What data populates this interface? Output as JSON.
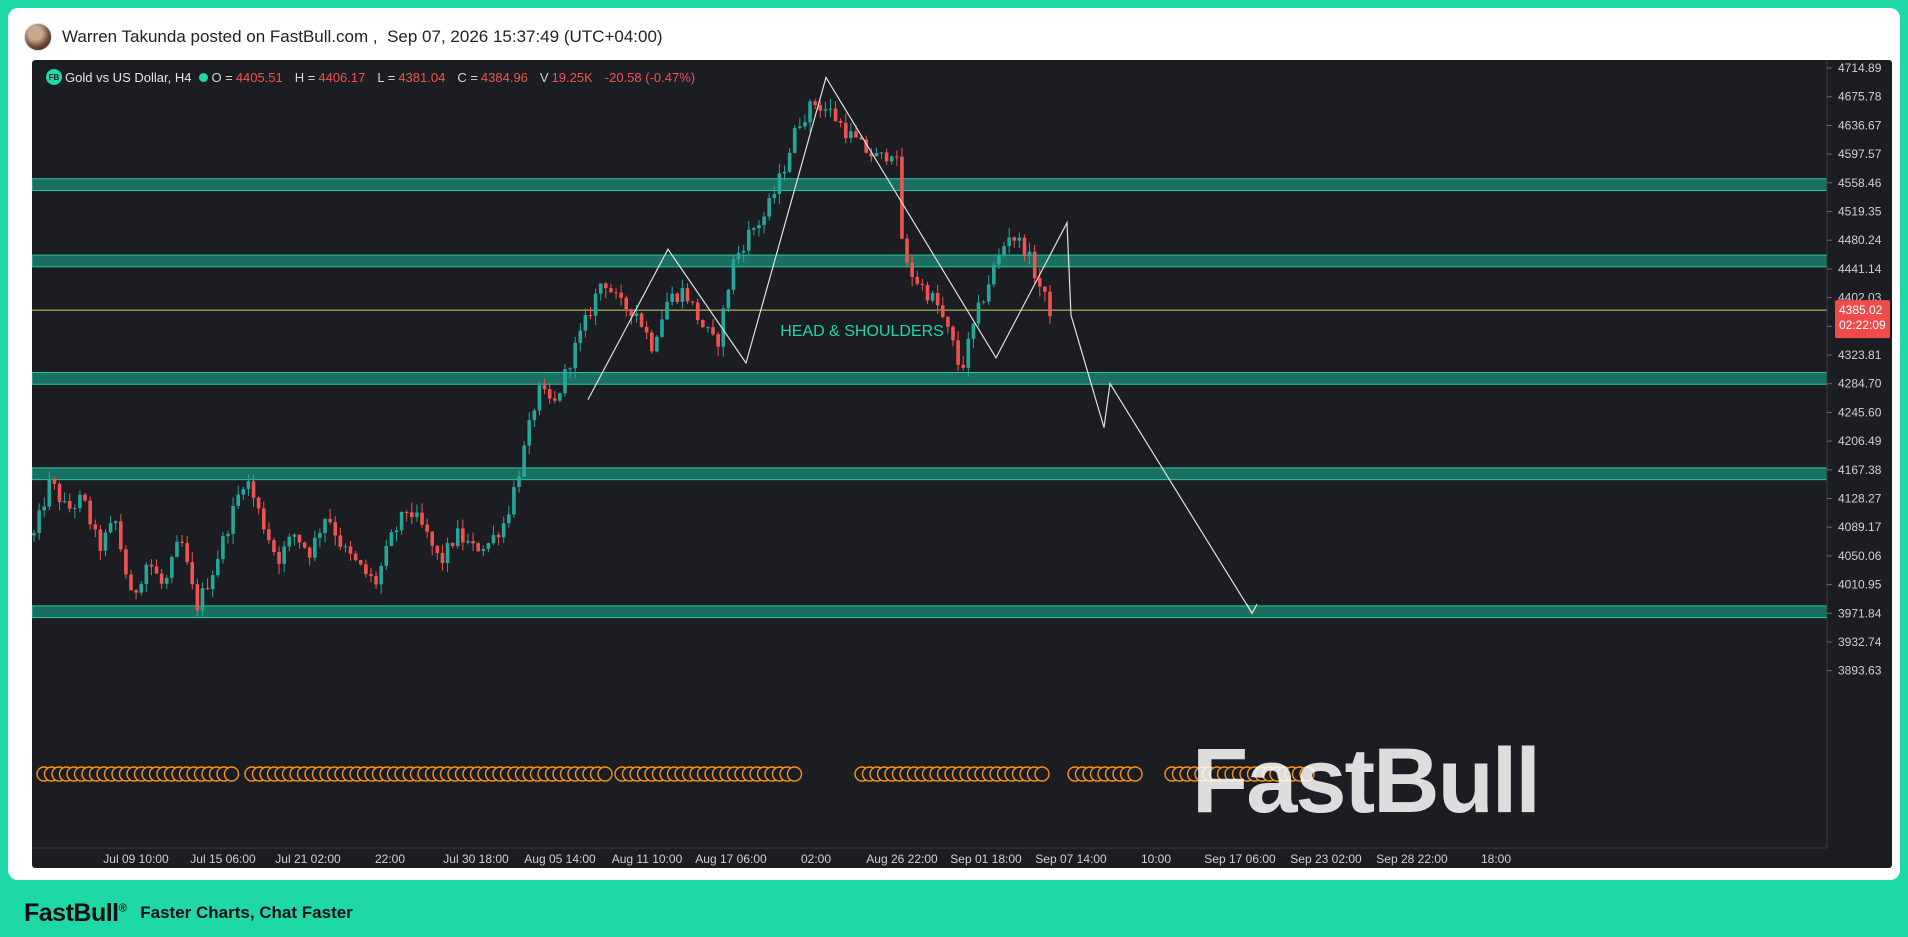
{
  "post": {
    "author": "Warren Takunda posted on FastBull.com",
    "separator": " ,  ",
    "timestamp": "Sep 07, 2026 15:37:49 (UTC+04:00)"
  },
  "legend": {
    "symbol": "Gold vs US Dollar, H4",
    "open_label": "O =",
    "open": "4405.51",
    "high_label": "H =",
    "high": "4406.17",
    "low_label": "L =",
    "low": "4381.04",
    "close_label": "C =",
    "close": "4384.96",
    "volume_label": "V",
    "volume": "19.25K",
    "change": "-20.58 (-0.47%)"
  },
  "colors": {
    "up": "#26a69a",
    "down": "#ef5350",
    "zone": "#1a8a78",
    "zone_border": "#23c9a0",
    "pattern_line": "#e0e0e0",
    "annotation": "#1fd8a8",
    "event": "#f7931a",
    "brand": "#1fd8a8"
  },
  "chart_data": {
    "type": "candlestick",
    "title": "Gold vs US Dollar, H4",
    "y_ticks": [
      "4714.89",
      "4675.78",
      "4636.67",
      "4597.57",
      "4558.46",
      "4519.35",
      "4480.24",
      "4441.14",
      "4402.03",
      "4363.92",
      "4323.81",
      "4284.70",
      "4245.60",
      "4206.49",
      "4167.38",
      "4128.27",
      "4089.17",
      "4050.06",
      "4010.95",
      "3971.84",
      "3932.74",
      "3893.63"
    ],
    "x_ticks": [
      "Jul 09 10:00",
      "Jul 15 06:00",
      "Jul 21 02:00",
      "22:00",
      "Jul 30 18:00",
      "Aug 05 14:00",
      "Aug 11 10:00",
      "Aug 17 06:00",
      "02:00",
      "Aug 26 22:00",
      "Sep 01 18:00",
      "Sep 07 14:00",
      "10:00",
      "Sep 17 06:00",
      "Sep 23 02:00",
      "Sep 28 22:00",
      "18:00"
    ],
    "ylim": [
      3860,
      4735
    ],
    "current_price": "4385.02",
    "countdown": "02:22:09",
    "zones": [
      [
        4548,
        4564
      ],
      [
        4444,
        4460
      ],
      [
        4284,
        4300
      ],
      [
        4154,
        4170
      ],
      [
        3966,
        3982
      ]
    ],
    "price_line": 4384.96,
    "annotation": "HEAD & SHOULDERS",
    "path_points": [
      {
        "t": 0.0,
        "p": 4078
      },
      {
        "t": 0.016,
        "p": 4152
      },
      {
        "t": 0.032,
        "p": 4112
      },
      {
        "t": 0.048,
        "p": 4128
      },
      {
        "t": 0.064,
        "p": 4060
      },
      {
        "t": 0.08,
        "p": 4098
      },
      {
        "t": 0.096,
        "p": 3990
      },
      {
        "t": 0.112,
        "p": 4045
      },
      {
        "t": 0.128,
        "p": 4005
      },
      {
        "t": 0.144,
        "p": 4075
      },
      {
        "t": 0.16,
        "p": 3980
      },
      {
        "t": 0.176,
        "p": 4030
      },
      {
        "t": 0.192,
        "p": 4095
      },
      {
        "t": 0.208,
        "p": 4160
      },
      {
        "t": 0.224,
        "p": 4100
      },
      {
        "t": 0.24,
        "p": 4045
      },
      {
        "t": 0.256,
        "p": 4080
      },
      {
        "t": 0.272,
        "p": 4055
      },
      {
        "t": 0.288,
        "p": 4110
      },
      {
        "t": 0.304,
        "p": 4060
      },
      {
        "t": 0.32,
        "p": 4035
      },
      {
        "t": 0.336,
        "p": 4012
      },
      {
        "t": 0.352,
        "p": 4075
      },
      {
        "t": 0.368,
        "p": 4115
      },
      {
        "t": 0.384,
        "p": 4085
      },
      {
        "t": 0.4,
        "p": 4040
      },
      {
        "t": 0.416,
        "p": 4080
      },
      {
        "t": 0.432,
        "p": 4060
      },
      {
        "t": 0.448,
        "p": 4068
      },
      {
        "t": 0.464,
        "p": 4098
      },
      {
        "t": 0.48,
        "p": 4180
      },
      {
        "t": 0.496,
        "p": 4275
      },
      {
        "t": 0.512,
        "p": 4255
      },
      {
        "t": 0.528,
        "p": 4318
      },
      {
        "t": 0.544,
        "p": 4372
      },
      {
        "t": 0.56,
        "p": 4430
      },
      {
        "t": 0.576,
        "p": 4392
      },
      {
        "t": 0.592,
        "p": 4385
      },
      {
        "t": 0.608,
        "p": 4338
      },
      {
        "t": 0.624,
        "p": 4400
      },
      {
        "t": 0.64,
        "p": 4412
      },
      {
        "t": 0.656,
        "p": 4368
      },
      {
        "t": 0.672,
        "p": 4335
      },
      {
        "t": 0.688,
        "p": 4450
      },
      {
        "t": 0.704,
        "p": 4490
      },
      {
        "t": 0.72,
        "p": 4515
      },
      {
        "t": 0.736,
        "p": 4570
      },
      {
        "t": 0.752,
        "p": 4640
      },
      {
        "t": 0.768,
        "p": 4668
      },
      {
        "t": 0.784,
        "p": 4655
      },
      {
        "t": 0.8,
        "p": 4628
      },
      {
        "t": 0.816,
        "p": 4605
      },
      {
        "t": 0.832,
        "p": 4590
      },
      {
        "t": 0.848,
        "p": 4608
      },
      {
        "t": 0.856,
        "p": 4450
      },
      {
        "t": 0.872,
        "p": 4420
      },
      {
        "t": 0.888,
        "p": 4395
      },
      {
        "t": 0.904,
        "p": 4340
      },
      {
        "t": 0.912,
        "p": 4300
      },
      {
        "t": 0.928,
        "p": 4378
      },
      {
        "t": 0.944,
        "p": 4440
      },
      {
        "t": 0.96,
        "p": 4490
      },
      {
        "t": 0.976,
        "p": 4468
      },
      {
        "t": 0.992,
        "p": 4410
      },
      {
        "t": 1.0,
        "p": 4385
      }
    ],
    "pattern_points": [
      {
        "label": "Aug 05 14:00",
        "p": 4263
      },
      {
        "label": "Aug 11 10:00",
        "p": 4468
      },
      {
        "label": "Aug 17 06:00",
        "p": 4313
      },
      {
        "label": "02:00",
        "p": 4702
      },
      {
        "label": "Sep 01 18:00",
        "p": 4320
      },
      {
        "label": "Sep 07 14:00",
        "p": 4504
      },
      {
        "label": "Sep 07 14:00",
        "p": 4378
      },
      {
        "label": "10:00",
        "p": 4225
      },
      {
        "label": "10:00",
        "p": 4285
      },
      {
        "label": "Sep 17 06:00",
        "p": 3972
      }
    ]
  },
  "watermark": "FastBull",
  "footer": {
    "logo": "FastBull",
    "tagline": "Faster Charts, Chat Faster"
  }
}
